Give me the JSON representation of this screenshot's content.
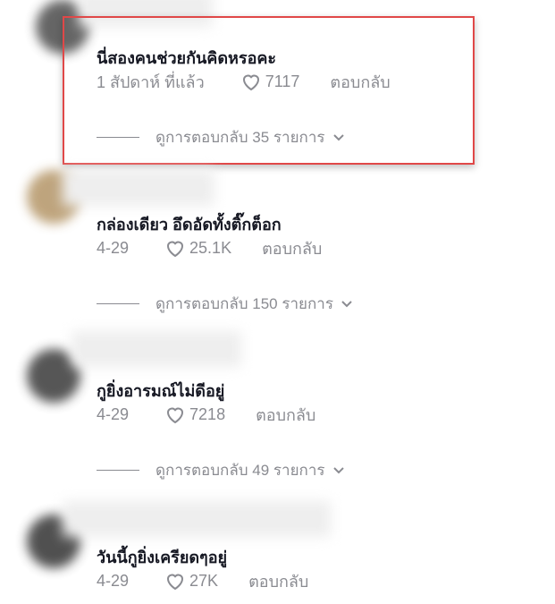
{
  "comments": [
    {
      "text": "นี่สองคนช่วยกันคิดหรอคะ",
      "date": "1 สัปดาห์ ที่แล้ว",
      "likes": "7117",
      "reply_label": "ตอบกลับ",
      "view_replies": "ดูการตอบกลับ 35 รายการ",
      "highlighted": true
    },
    {
      "text": "กล่องเดียว อึดอัดทั้งติ๊กต็อก",
      "date": "4-29",
      "likes": "25.1K",
      "reply_label": "ตอบกลับ",
      "view_replies": "ดูการตอบกลับ 150 รายการ"
    },
    {
      "text": "กูยิ่งอารมณ์ไม่ดีอยู่",
      "date": "4-29",
      "likes": "7218",
      "reply_label": "ตอบกลับ",
      "view_replies": "ดูการตอบกลับ 49 รายการ"
    },
    {
      "text": "วันนี้กูยิ่งเครียดๆอยู่",
      "date": "4-29",
      "likes": "27K",
      "reply_label": "ตอบกลับ"
    }
  ],
  "colors": {
    "highlight_border": "#e04848",
    "text": "#161823",
    "muted": "#8a8b91"
  },
  "icons": {
    "like": "heart-outline-icon",
    "expand": "chevron-down-icon"
  }
}
